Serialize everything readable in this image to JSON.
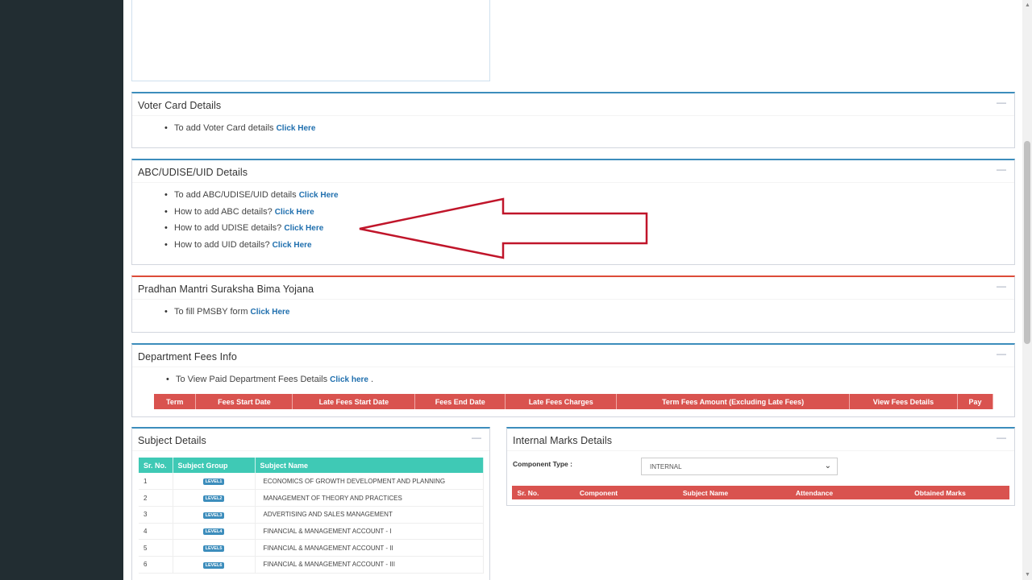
{
  "colors": {
    "sidebar": "#222d32",
    "primary_border": "#3c8dbc",
    "danger_border": "#dd4b39",
    "table_header_red": "#d9534f",
    "table_header_teal": "#3fc9b5",
    "link": "#1f6fae",
    "arrow": "#c0152a"
  },
  "voter": {
    "title": "Voter Card Details",
    "items": [
      {
        "text": "To add Voter Card details ",
        "link": "Click Here"
      }
    ]
  },
  "abc": {
    "title": "ABC/UDISE/UID Details",
    "items": [
      {
        "text": "To add ABC/UDISE/UID details ",
        "link": "Click Here"
      },
      {
        "text": "How to add ABC details? ",
        "link": "Click Here"
      },
      {
        "text": "How to add UDISE details? ",
        "link": "Click Here"
      },
      {
        "text": "How to add UID details? ",
        "link": "Click Here"
      }
    ]
  },
  "pmsby": {
    "title": "Pradhan Mantri Suraksha Bima Yojana",
    "items": [
      {
        "text": "To fill PMSBY form ",
        "link": "Click Here"
      }
    ]
  },
  "fees": {
    "title": "Department Fees Info",
    "item": {
      "text": "To View Paid Department Fees Details ",
      "link": "Click here",
      "suffix": " ."
    },
    "columns": [
      "Term",
      "Fees Start Date",
      "Late Fees Start Date",
      "Fees End Date",
      "Late Fees Charges",
      "Term Fees Amount (Excluding Late Fees)",
      "View Fees Details",
      "Pay"
    ]
  },
  "subjects": {
    "title": "Subject Details",
    "columns": [
      "Sr. No.",
      "Subject Group",
      "Subject Name"
    ],
    "rows": [
      {
        "sr": "1",
        "group": "LEVEL1",
        "name": "ECONOMICS OF GROWTH DEVELOPMENT AND PLANNING"
      },
      {
        "sr": "2",
        "group": "LEVEL2",
        "name": "MANAGEMENT OF THEORY AND PRACTICES"
      },
      {
        "sr": "3",
        "group": "LEVEL3",
        "name": "ADVERTISING AND SALES MANAGEMENT"
      },
      {
        "sr": "4",
        "group": "LEVEL4",
        "name": "FINANCIAL & MANAGEMENT ACCOUNT - I"
      },
      {
        "sr": "5",
        "group": "LEVEL5",
        "name": "FINANCIAL & MANAGEMENT ACCOUNT - II"
      },
      {
        "sr": "6",
        "group": "LEVEL6",
        "name": "FINANCIAL & MANAGEMENT ACCOUNT - III"
      }
    ]
  },
  "marks": {
    "title": "Internal Marks Details",
    "component_label": "Component Type :",
    "component_value": "INTERNAL",
    "columns": [
      "Sr. No.",
      "Component",
      "Subject Name",
      "Attendance",
      "Obtained Marks"
    ]
  },
  "icons": {
    "collapse": "minus-icon",
    "select": "chevron-down-icon",
    "annotation": "arrow-left-annotation"
  }
}
